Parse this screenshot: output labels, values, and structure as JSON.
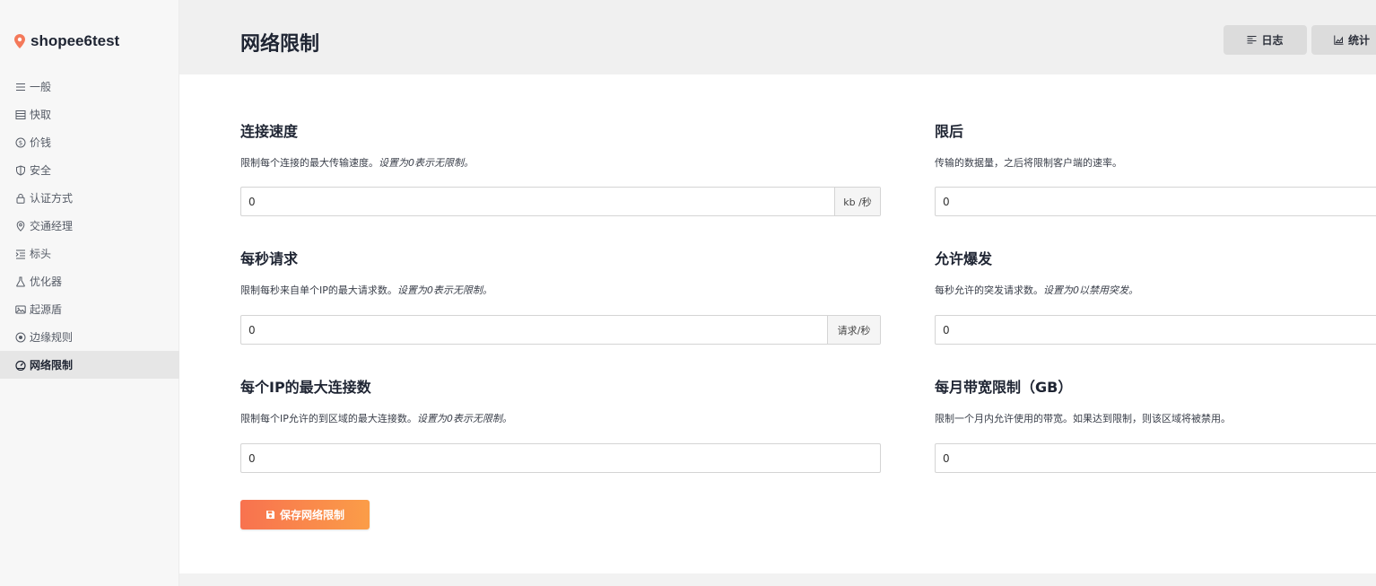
{
  "app": {
    "site_name": "shopee6test"
  },
  "sidebar": {
    "items": [
      {
        "label": "一般",
        "icon": "list-icon"
      },
      {
        "label": "快取",
        "icon": "storage-icon"
      },
      {
        "label": "价钱",
        "icon": "dollar-icon"
      },
      {
        "label": "安全",
        "icon": "shield-icon"
      },
      {
        "label": "认证方式",
        "icon": "lock-icon"
      },
      {
        "label": "交通经理",
        "icon": "location-icon"
      },
      {
        "label": "标头",
        "icon": "indent-icon"
      },
      {
        "label": "优化器",
        "icon": "flask-icon"
      },
      {
        "label": "起源盾",
        "icon": "shield-image-icon"
      },
      {
        "label": "边缘规则",
        "icon": "target-icon"
      },
      {
        "label": "网络限制",
        "icon": "gauge-icon",
        "active": true
      }
    ]
  },
  "header": {
    "title": "网络限制",
    "logs_label": "日志",
    "stats_label": "统计"
  },
  "fields": {
    "connection_speed": {
      "title": "连接速度",
      "desc": "限制每个连接的最大传输速度。",
      "desc_italic": "设置为0表示无限制。",
      "value": "0",
      "unit": "kb /秒"
    },
    "limit_after": {
      "title": "限后",
      "desc": "传输的数据量，之后将限制客户端的速率。",
      "desc_italic": "",
      "value": "0"
    },
    "requests_per_second": {
      "title": "每秒请求",
      "desc": "限制每秒来自单个IP的最大请求数。",
      "desc_italic": "设置为0表示无限制。",
      "value": "0",
      "unit": "请求/秒"
    },
    "allow_burst": {
      "title": "允许爆发",
      "desc": "每秒允许的突发请求数。",
      "desc_italic": "设置为0以禁用突发。",
      "value": "0"
    },
    "max_connections_per_ip": {
      "title": "每个IP的最大连接数",
      "desc": "限制每个IP允许的到区域的最大连接数。",
      "desc_italic": "设置为0表示无限制。",
      "value": "0"
    },
    "monthly_bandwidth_limit": {
      "title": "每月带宽限制（GB）",
      "desc": "限制一个月内允许使用的带宽。如果达到限制，则该区域将被禁用。",
      "desc_italic": "",
      "value": "0"
    }
  },
  "save_button": {
    "label": "保存网络限制"
  },
  "colors": {
    "accent_start": "#f8724f",
    "accent_end": "#fb9d48",
    "pin": "#f4795a"
  }
}
